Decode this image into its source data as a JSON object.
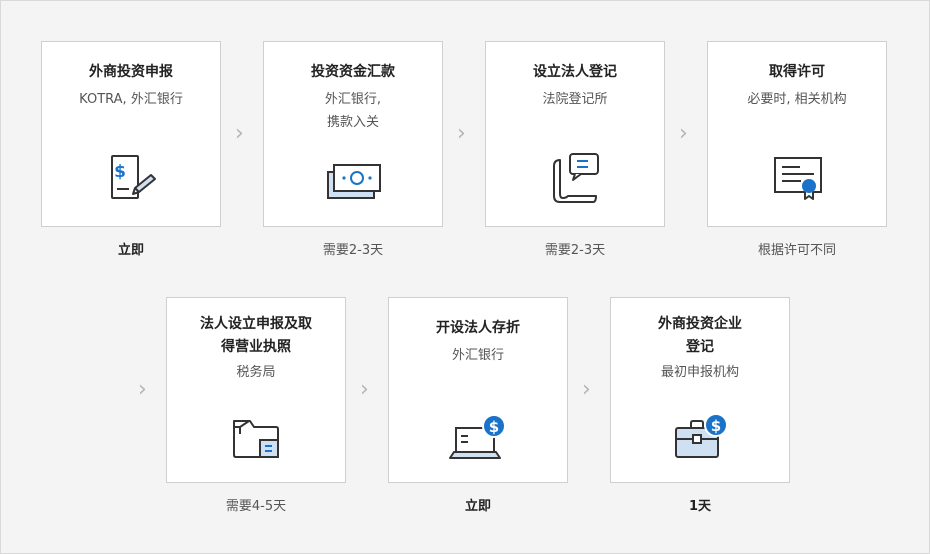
{
  "steps": [
    {
      "title": "外商投资申报",
      "sub": "KOTRA, 外汇银行",
      "duration": "立即",
      "icon": "document-sign-icon"
    },
    {
      "title": "投资资金汇款",
      "sub": "外汇银行,\n携款入关",
      "duration": "需要2-3天",
      "icon": "banknotes-icon"
    },
    {
      "title": "设立法人登记",
      "sub": "法院登记所",
      "duration": "需要2-3天",
      "icon": "scroll-speech-icon"
    },
    {
      "title": "取得许可",
      "sub": "必要时, 相关机构",
      "duration": "根据许可不同",
      "icon": "certificate-icon"
    },
    {
      "title": "法人设立申报及取\n得营业执照",
      "sub": "税务局",
      "duration": "需要4-5天",
      "icon": "folder-icon"
    },
    {
      "title": "开设法人存折",
      "sub": "外汇银行",
      "duration": "立即",
      "icon": "laptop-dollar-icon"
    },
    {
      "title": "外商投资企业\n登记",
      "sub": "最初申报机构",
      "duration": "1天",
      "icon": "briefcase-dollar-icon"
    }
  ],
  "chevron": "›",
  "colors": {
    "accent": "#1a73c9",
    "icon_fill": "#cfe0f3",
    "outline": "#333333"
  }
}
